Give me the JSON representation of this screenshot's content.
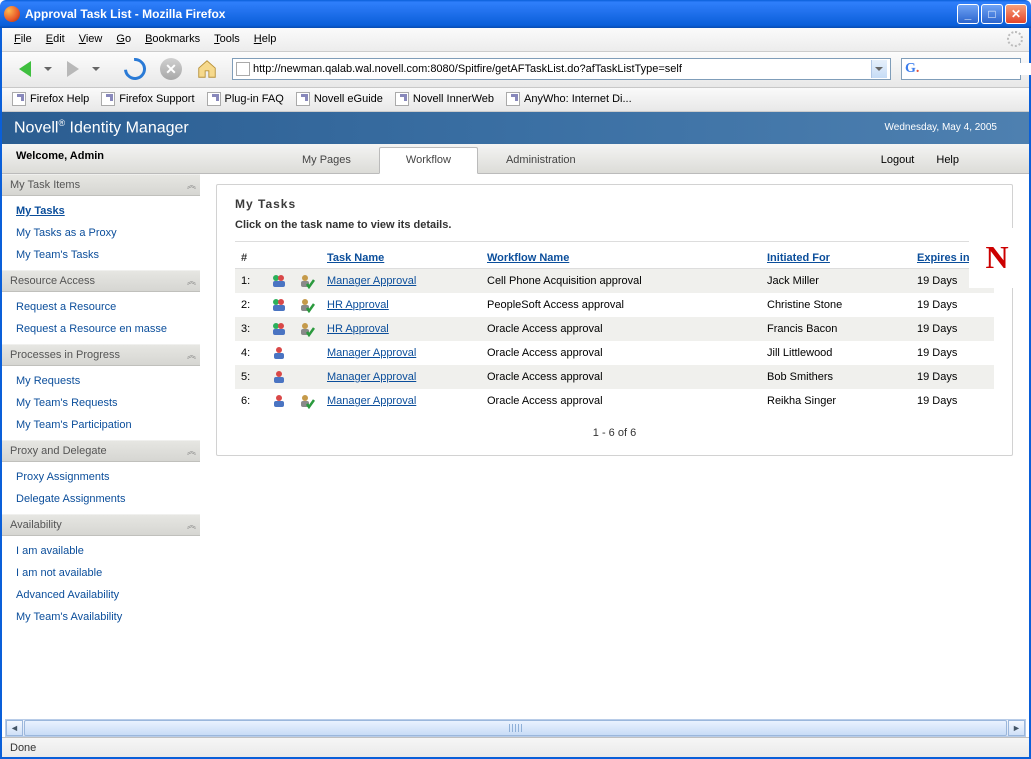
{
  "window": {
    "title": "Approval Task List - Mozilla Firefox"
  },
  "menu": {
    "file": "File",
    "edit": "Edit",
    "view": "View",
    "go": "Go",
    "bookmarks": "Bookmarks",
    "tools": "Tools",
    "help": "Help"
  },
  "url": "http://newman.qalab.wal.novell.com:8080/Spitfire/getAFTaskList.do?afTaskListType=self",
  "bookmarks_bar": [
    "Firefox Help",
    "Firefox Support",
    "Plug-in FAQ",
    "Novell eGuide",
    "Novell InnerWeb",
    "AnyWho: Internet Di..."
  ],
  "app": {
    "brand": "Novell® Identity Manager",
    "date": "Wednesday, May 4, 2005",
    "logo": "N"
  },
  "welcome": "Welcome, Admin",
  "nav_tabs": {
    "mypages": "My Pages",
    "workflow": "Workflow",
    "admin": "Administration"
  },
  "top_links": {
    "logout": "Logout",
    "help": "Help"
  },
  "sidebar": {
    "groups": [
      {
        "title": "My Task Items",
        "items": [
          "My Tasks",
          "My Tasks as a Proxy",
          "My Team's Tasks"
        ],
        "activeIndex": 0
      },
      {
        "title": "Resource Access",
        "items": [
          "Request a Resource",
          "Request a Resource en masse"
        ]
      },
      {
        "title": "Processes in Progress",
        "items": [
          "My Requests",
          "My Team's Requests",
          "My Team's Participation"
        ]
      },
      {
        "title": "Proxy and Delegate",
        "items": [
          "Proxy Assignments",
          "Delegate Assignments"
        ]
      },
      {
        "title": "Availability",
        "items": [
          "I am available",
          "I am not available",
          "Advanced Availability",
          "My Team's Availability"
        ]
      }
    ]
  },
  "panel": {
    "title": "My Tasks",
    "instruction": "Click on the task name to view its details.",
    "columns": {
      "num": "#",
      "task": "Task Name",
      "wf": "Workflow Name",
      "init": "Initiated For",
      "exp": "Expires in"
    },
    "rows": [
      {
        "n": "1:",
        "icon1": "users",
        "icon2": "check",
        "task": "Manager Approval",
        "wf": "Cell Phone Acquisition approval",
        "init": "Jack Miller",
        "exp": "19 Days"
      },
      {
        "n": "2:",
        "icon1": "users",
        "icon2": "check",
        "task": "HR Approval",
        "wf": "PeopleSoft Access approval",
        "init": "Christine Stone",
        "exp": "19 Days"
      },
      {
        "n": "3:",
        "icon1": "users",
        "icon2": "check",
        "task": "HR Approval",
        "wf": "Oracle Access approval",
        "init": "Francis Bacon",
        "exp": "19 Days"
      },
      {
        "n": "4:",
        "icon1": "user",
        "icon2": "",
        "task": "Manager Approval",
        "wf": "Oracle Access approval",
        "init": "Jill Littlewood",
        "exp": "19 Days"
      },
      {
        "n": "5:",
        "icon1": "user",
        "icon2": "",
        "task": "Manager Approval",
        "wf": "Oracle Access approval",
        "init": "Bob Smithers",
        "exp": "19 Days"
      },
      {
        "n": "6:",
        "icon1": "user",
        "icon2": "check",
        "task": "Manager Approval",
        "wf": "Oracle Access approval",
        "init": "Reikha Singer",
        "exp": "19 Days"
      }
    ],
    "pager": "1 - 6 of 6"
  },
  "status": "Done",
  "searchengine_letter": "G"
}
